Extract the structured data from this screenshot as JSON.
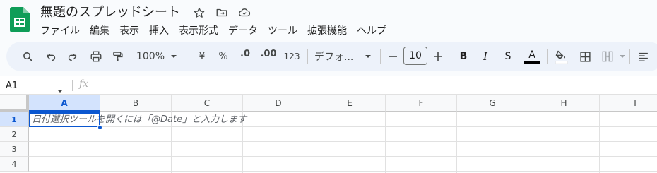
{
  "app": {
    "doc_title": "無題のスプレッドシート",
    "brand_color": "#0f9d58",
    "title_icons": [
      "star-icon",
      "move-to-folder-icon",
      "cloud-status-icon"
    ]
  },
  "menu": [
    "ファイル",
    "編集",
    "表示",
    "挿入",
    "表示形式",
    "データ",
    "ツール",
    "拡張機能",
    "ヘルプ"
  ],
  "toolbar": {
    "zoom": "100%",
    "currency_label": "¥",
    "percent_label": "%",
    "decrease_decimal_label": ".0",
    "increase_decimal_label": ".00",
    "number_format_label": "123",
    "font_name": "デフォ...",
    "font_size": "10",
    "decrease_font_label": "—",
    "increase_font_label": "+",
    "bold_label": "B",
    "italic_label": "I",
    "strike_label": "S",
    "text_color_label": "A",
    "icons": [
      "search-icon",
      "undo-icon",
      "redo-icon",
      "print-icon",
      "paint-format-icon",
      "fill-color-icon",
      "borders-icon",
      "merge-cells-icon",
      "align-left-icon"
    ]
  },
  "formula_bar": {
    "cell_reference": "A1",
    "fx_label": "fx",
    "value": ""
  },
  "grid": {
    "columns": [
      "A",
      "B",
      "C",
      "D",
      "E",
      "F",
      "G",
      "H",
      "I"
    ],
    "rows": [
      "1",
      "2",
      "3",
      "4"
    ],
    "selected_column": "A",
    "selected_row": "1",
    "cell_hint": "日付選択ツールを開くには「@Date」と入力します",
    "selection_color": "#0b57d0"
  }
}
